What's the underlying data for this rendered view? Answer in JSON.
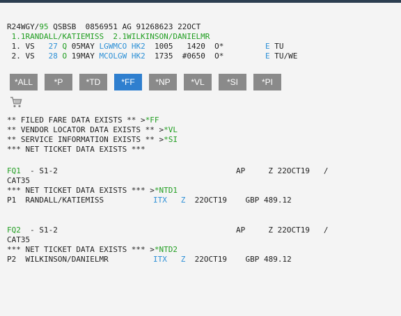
{
  "pnr_header": {
    "record_locator": "R24WGY",
    "slash": "/",
    "agent_code": "95",
    "pcc": "QSBSB",
    "phone": "0856951",
    "agency": "AG",
    "iata": "91268623",
    "date": "22OCT"
  },
  "passengers_line": " 1.1RANDALL/KATIEMISS  2.1WILKINSON/DANIELMR",
  "segments": [
    {
      "num": " 1.",
      "carrier": "VS",
      "flight": "27",
      "cls": "Q",
      "date": "05MAY",
      "citypair": "LGWMCO",
      "status": "HK2",
      "dep": "1005",
      "arr": "1420",
      "flag": "O*",
      "e": "E",
      "days": "TU"
    },
    {
      "num": " 2.",
      "carrier": "VS",
      "flight": "28",
      "cls": "O",
      "date": "19MAY",
      "citypair": "MCOLGW",
      "status": "HK2",
      "dep": "1735",
      "arr": "#0650",
      "flag": "O*",
      "e": "E",
      "days": "TU/WE"
    }
  ],
  "buttons": [
    {
      "label": "*ALL",
      "active": false
    },
    {
      "label": "*P",
      "active": false
    },
    {
      "label": "*TD",
      "active": false
    },
    {
      "label": "*FF",
      "active": true
    },
    {
      "label": "*NP",
      "active": false
    },
    {
      "label": "*VL",
      "active": false
    },
    {
      "label": "*SI",
      "active": false
    },
    {
      "label": "*PI",
      "active": false
    }
  ],
  "icons": {
    "cart": "shopping-cart-icon"
  },
  "colors": {
    "green": "#1f9d1f",
    "blue": "#2b8fd6",
    "active_button": "#2f7fcf",
    "button": "#8a8a8a"
  },
  "notices": {
    "filed_fare_text": "** FILED FARE DATA EXISTS ** >",
    "filed_fare_link": "*FF",
    "vendor_text": "** VENDOR LOCATOR DATA EXISTS ** >",
    "vendor_link": "*VL",
    "service_text": "** SERVICE INFORMATION EXISTS ** >",
    "service_link": "*SI",
    "net_ticket": "*** NET TICKET DATA EXISTS ***"
  },
  "fare_quotes": [
    {
      "fq": "FQ1",
      "seg": "  - S1-2",
      "ap": "AP",
      "z": "Z",
      "zdate": "22OCT19",
      "slash": "/",
      "cat": "CAT35",
      "net_text": "*** NET TICKET DATA EXISTS *** >",
      "net_link": "*NTD1",
      "pax": "P1  RANDALL/KATIEMISS",
      "itx": "ITX",
      "z2": "Z",
      "date": "22OCT19",
      "amount": "GBP 489.12"
    },
    {
      "fq": "FQ2",
      "seg": "  - S1-2",
      "ap": "AP",
      "z": "Z",
      "zdate": "22OCT19",
      "slash": "/",
      "cat": "CAT35",
      "net_text": "*** NET TICKET DATA EXISTS *** >",
      "net_link": "*NTD2",
      "pax": "P2  WILKINSON/DANIELMR",
      "itx": "ITX",
      "z2": "Z",
      "date": "22OCT19",
      "amount": "GBP 489.12"
    }
  ]
}
